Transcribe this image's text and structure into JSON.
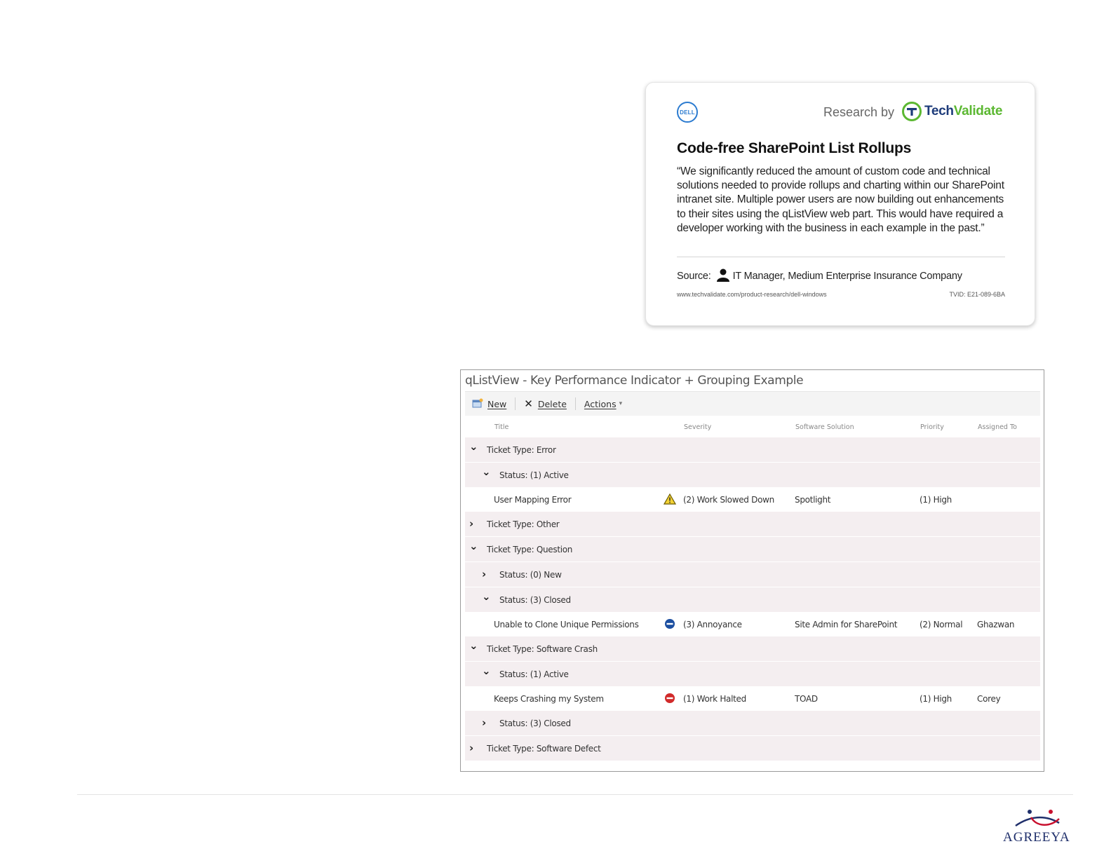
{
  "techvalidate_card": {
    "dell_logo": "DELL",
    "research_by": "Research by",
    "brand_tech": "Tech",
    "brand_validate": "Validate",
    "title": "Code-free SharePoint List Rollups",
    "quote": "“We significantly reduced the amount of custom code and technical solutions needed to provide rollups and charting within our SharePoint intranet site. Multiple power users are now building out enhancements to their sites using the qListView web part. This would have required a developer working with the business in each example in the past.”",
    "source_label": "Source:",
    "source_value": "IT Manager, Medium Enterprise Insurance Company",
    "url": "www.techvalidate.com/product-research/dell-windows",
    "tvid": "TVID: E21-089-6BA"
  },
  "qlistview": {
    "title": "qListView - Key Performance Indicator + Grouping Example",
    "toolbar": {
      "new_label": "New",
      "delete_label": "Delete",
      "actions_label": "Actions"
    },
    "columns": {
      "title": "Title",
      "severity": "Severity",
      "software": "Software Solution",
      "priority": "Priority",
      "assigned": "Assigned To"
    },
    "rows": [
      {
        "kind": "group",
        "level": 1,
        "expanded": true,
        "label": "Ticket Type: Error"
      },
      {
        "kind": "group",
        "level": 2,
        "expanded": true,
        "label": "Status: (1) Active"
      },
      {
        "kind": "item",
        "title": "User Mapping Error",
        "severity_icon": "warning-icon",
        "severity": "(2) Work Slowed Down",
        "software": "Spotlight",
        "priority": "(1) High",
        "assigned": ""
      },
      {
        "kind": "group",
        "level": 1,
        "expanded": false,
        "label": "Ticket Type: Other"
      },
      {
        "kind": "group",
        "level": 1,
        "expanded": true,
        "label": "Ticket Type: Question"
      },
      {
        "kind": "group",
        "level": 2,
        "expanded": false,
        "label": "Status: (0) New"
      },
      {
        "kind": "group",
        "level": 2,
        "expanded": true,
        "label": "Status: (3) Closed"
      },
      {
        "kind": "item",
        "title": "Unable to Clone Unique Permissions",
        "severity_icon": "minus-circle-icon",
        "severity": "(3) Annoyance",
        "software": "Site Admin for SharePoint",
        "priority": "(2) Normal",
        "assigned": "Ghazwan"
      },
      {
        "kind": "group",
        "level": 1,
        "expanded": true,
        "label": "Ticket Type: Software Crash"
      },
      {
        "kind": "group",
        "level": 2,
        "expanded": true,
        "label": "Status: (1) Active"
      },
      {
        "kind": "item",
        "title": "Keeps Crashing my System",
        "severity_icon": "stop-icon",
        "severity": "(1) Work Halted",
        "software": "TOAD",
        "priority": "(1) High",
        "assigned": "Corey"
      },
      {
        "kind": "group",
        "level": 2,
        "expanded": false,
        "label": "Status: (3) Closed"
      },
      {
        "kind": "group",
        "level": 1,
        "expanded": false,
        "label": "Ticket Type: Software Defect"
      }
    ]
  },
  "footer": {
    "logo_text": "AGREEYA"
  },
  "colors": {
    "group_row": "#f4eef0",
    "techvalidate_green": "#5cb832",
    "techvalidate_navy": "#1d3b7a",
    "dell_blue": "#2b7bd0",
    "agreeya_navy": "#1f2f6b",
    "agreeya_red": "#c8102e"
  }
}
